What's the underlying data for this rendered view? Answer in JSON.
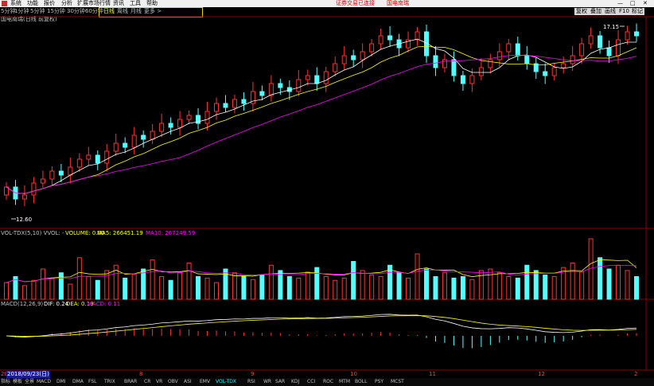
{
  "menu": {
    "items": [
      "系统",
      "功能",
      "报价",
      "分析",
      "扩展市场行情",
      "资讯",
      "工具",
      "帮助"
    ],
    "alert": "证券交易已连接",
    "alert_name": "国电南瑞",
    "window_controls": [
      "—",
      "□",
      "✕"
    ]
  },
  "periods": [
    "5分钟",
    "1分钟",
    "5分钟",
    "15分钟",
    "30分钟",
    "60分钟",
    "日线",
    "周线",
    "月线",
    "更多 >"
  ],
  "selected_period": "日线",
  "toolbar_buttons": [
    "复权",
    "叠加",
    "画线",
    "F10",
    "标记"
  ],
  "stock_title": "国电南瑞(日线 前复权)",
  "price_markers": {
    "high": "17.15",
    "low": "12.60"
  },
  "volume_legend": {
    "label": "VOL-TDX(5,10) VVOL: -",
    "volume": "VOLUME: 0.00",
    "ma5": "MA5: 266451.19",
    "ma10": "MA10: 267249.59"
  },
  "macd_legend": {
    "label": "MACD(12,26,9)",
    "dif": "DIF: 0.24",
    "dea": "DEA: 0.19",
    "macd": "MACD: 0.11"
  },
  "current_date": "2018/09/23(日)",
  "month_ticks": [
    "20",
    "8",
    "9",
    "10",
    "11",
    "12",
    "2"
  ],
  "indicator_tabs": [
    "指标",
    "模板",
    "全景",
    "MACD",
    "DMI",
    "DMA",
    "FSL",
    "TRIX",
    "BRAR",
    "CR",
    "VR",
    "OBV",
    "ASI",
    "EMV",
    "VOL-TDX",
    "RSI",
    "WR",
    "SAR",
    "KDJ",
    "CCI",
    "ROC",
    "MTM",
    "BOLL",
    "PSY",
    "MCST"
  ],
  "selected_tab": "VOL-TDX",
  "colors": {
    "up": "#ff3232",
    "down": "#54ffff",
    "ma_white": "#ffffff",
    "ma_yellow": "#ffff00",
    "ma_magenta": "#ff00ff",
    "grid": "#8b0000",
    "highlight": "#e8d400"
  },
  "chart_data": [
    {
      "type": "candlestick",
      "title": "国电南瑞(日线 前复权)",
      "close": [
        13.2,
        12.9,
        13.0,
        13.3,
        13.4,
        13.6,
        13.5,
        13.7,
        13.9,
        14.0,
        13.8,
        14.1,
        14.3,
        14.2,
        14.5,
        14.4,
        14.6,
        14.8,
        14.7,
        14.9,
        15.0,
        14.8,
        15.1,
        15.3,
        15.2,
        15.4,
        15.3,
        15.6,
        15.5,
        15.8,
        15.7,
        15.6,
        15.9,
        16.0,
        15.8,
        16.1,
        16.3,
        16.5,
        16.4,
        16.6,
        16.8,
        17.0,
        16.9,
        16.7,
        16.9,
        17.1,
        16.5,
        16.2,
        16.4,
        16.0,
        15.8,
        16.0,
        16.2,
        16.4,
        16.6,
        16.8,
        16.5,
        16.3,
        16.1,
        16.0,
        16.2,
        16.3,
        16.5,
        16.8,
        17.0,
        16.7,
        16.5,
        16.9,
        17.1,
        17.0
      ],
      "ylim": [
        12.5,
        17.3
      ],
      "high_label": "17.15",
      "low_label": "12.60"
    },
    {
      "type": "bar",
      "title": "VOL-TDX(5,10)",
      "values": [
        22,
        30,
        18,
        25,
        40,
        28,
        35,
        20,
        55,
        30,
        25,
        38,
        45,
        28,
        33,
        40,
        52,
        30,
        25,
        35,
        48,
        30,
        28,
        22,
        40,
        35,
        30,
        26,
        32,
        45,
        38,
        30,
        28,
        36,
        42,
        30,
        25,
        28,
        50,
        38,
        32,
        30,
        45,
        35,
        28,
        60,
        40,
        30,
        35,
        28,
        30,
        26,
        38,
        40,
        35,
        30,
        28,
        45,
        38,
        32,
        30,
        42,
        48,
        36,
        80,
        55,
        40,
        45,
        38,
        30
      ],
      "ma5": 266451.19,
      "ma10": 267249.59
    },
    {
      "type": "line",
      "title": "MACD(12,26,9)",
      "dif": 0.24,
      "dea": 0.19,
      "macd": 0.11
    }
  ]
}
